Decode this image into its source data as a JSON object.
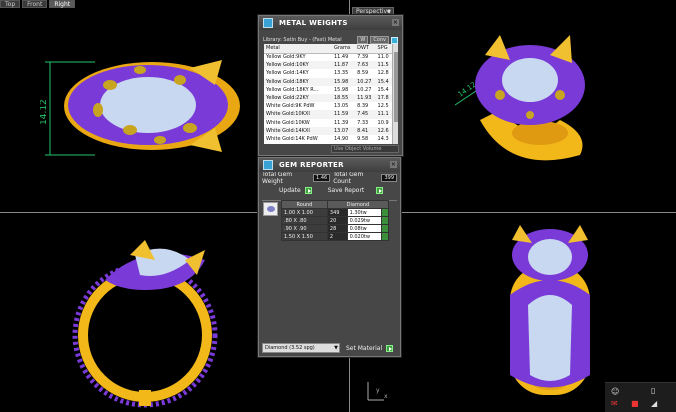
{
  "viewport_tabs": [
    "Top",
    "Front",
    "Right"
  ],
  "perspective_label": "Perspective",
  "dimension_label": "14.12",
  "axis_labels": {
    "x": "x",
    "y": "y"
  },
  "metal_weights": {
    "title": "METAL WEIGHTS",
    "library": "Library: Satin Buy - (Fast) Metal",
    "btn_w": "W",
    "btn_conv": "Conv",
    "columns": [
      "Metal",
      "Grams",
      "DWT",
      "SPG"
    ],
    "rows": [
      [
        "Yellow Gold:9KY",
        "11.49",
        "7.39",
        "11.0"
      ],
      [
        "Yellow Gold:10KY",
        "11.87",
        "7.63",
        "11.5"
      ],
      [
        "Yellow Gold:14KY",
        "13.35",
        "8.59",
        "12.8"
      ],
      [
        "Yellow Gold:18KY",
        "15.98",
        "10.27",
        "15.4"
      ],
      [
        "Yellow Gold:18KY R...",
        "15.98",
        "10.27",
        "15.4"
      ],
      [
        "Yellow Gold:22KY",
        "18.55",
        "11.93",
        "17.8"
      ],
      [
        "White Gold:9K PdW",
        "13.05",
        "8.39",
        "12.5"
      ],
      [
        "White Gold:10KXI",
        "11.59",
        "7.45",
        "11.1"
      ],
      [
        "White Gold:10KW",
        "11.39",
        "7.33",
        "10.9"
      ],
      [
        "White Gold:14KXI",
        "13.07",
        "8.41",
        "12.6"
      ],
      [
        "White Gold:14K PdW",
        "14.90",
        "9.58",
        "14.3"
      ]
    ],
    "footer": "Use Object Volume"
  },
  "gem_reporter": {
    "title": "GEM REPORTER",
    "total_weight_label": "Total Gem Weight",
    "total_weight_value": "1.46",
    "total_count_label": "Total Gem Count",
    "total_count_value": "399",
    "update_label": "Update",
    "save_report_label": "Save Report",
    "columns": [
      "Round",
      "Diamond"
    ],
    "rows": [
      [
        "1.00 X 1.00",
        "349",
        "1.30tw"
      ],
      [
        ".80 X .80",
        "20",
        "0.029tw"
      ],
      [
        ".90 X .90",
        "28",
        "0.08tw"
      ],
      [
        "1.50 X 1.50",
        "2",
        "0.020tw"
      ]
    ],
    "material_select": "Diamond     (3.52 spg)",
    "set_material_label": "Set Material"
  },
  "colors": {
    "gold": "#f2b81a",
    "gem_purple": "#7a3ad8",
    "diamond": "#d9e6ff",
    "panel": "#474747",
    "accent_green": "#3d9e3d",
    "dimension": "#23c36a"
  }
}
